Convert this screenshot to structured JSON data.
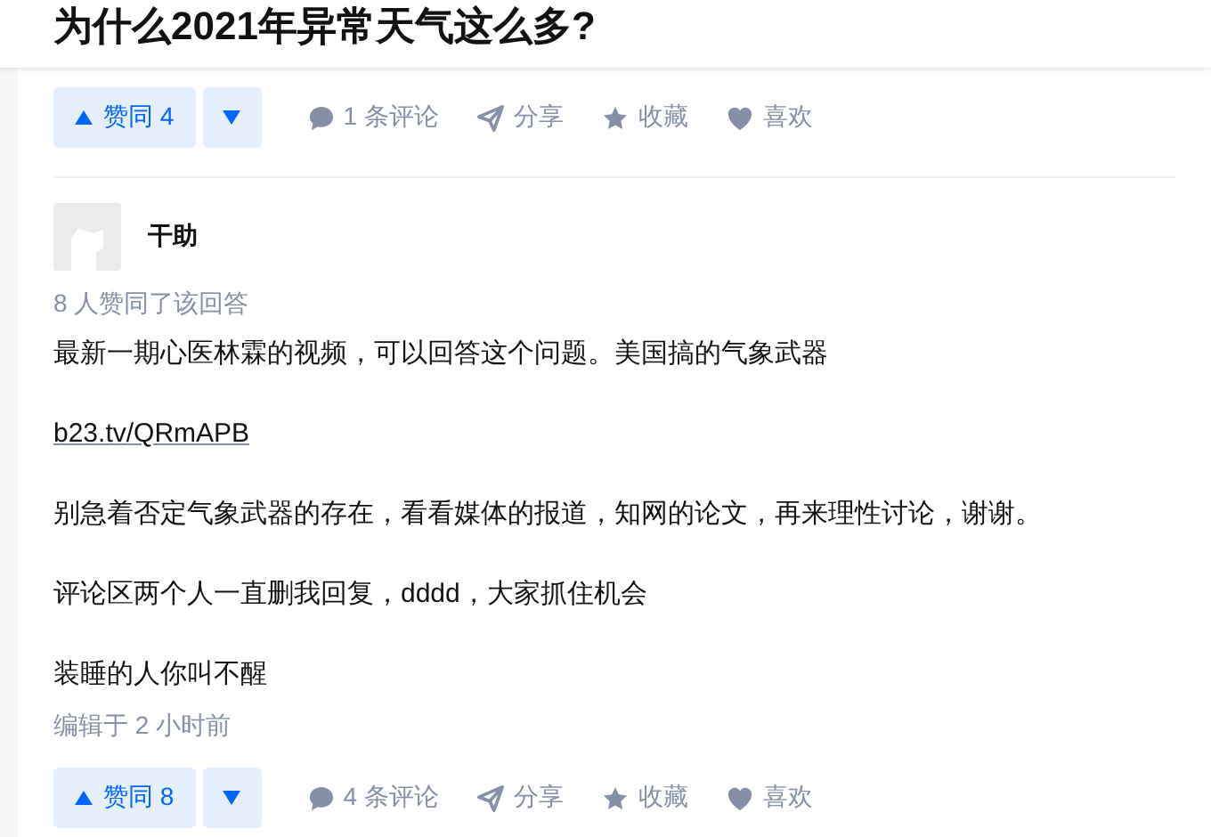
{
  "question": {
    "title": "为什么2021年异常天气这么多?"
  },
  "question_actions": [
    {
      "kind": "upvote",
      "label": "赞同 4"
    },
    {
      "kind": "downvote"
    },
    {
      "kind": "comment",
      "label": "1 条评论"
    },
    {
      "kind": "share",
      "label": "分享"
    },
    {
      "kind": "favorite",
      "label": "收藏"
    },
    {
      "kind": "like",
      "label": "喜欢"
    }
  ],
  "answer": {
    "author": "干助",
    "upvote_summary": "8 人赞同了该回答",
    "paragraphs": [
      {
        "kind": "text",
        "text": "最新一期心医林霖的视频，可以回答这个问题。美国搞的气象武器"
      },
      {
        "kind": "link",
        "text": "b23.tv/QRmAPB"
      },
      {
        "kind": "text",
        "text": "别急着否定气象武器的存在，看看媒体的报道，知网的论文，再来理性讨论，谢谢。"
      },
      {
        "kind": "text",
        "text": "评论区两个人一直删我回复，dddd，大家抓住机会"
      },
      {
        "kind": "text",
        "text": "装睡的人你叫不醒"
      }
    ],
    "edited": "编辑于 2 小时前",
    "actions": [
      {
        "kind": "upvote",
        "label": "赞同 8"
      },
      {
        "kind": "downvote"
      },
      {
        "kind": "comment",
        "label": "4 条评论"
      },
      {
        "kind": "share",
        "label": "分享"
      },
      {
        "kind": "favorite",
        "label": "收藏"
      },
      {
        "kind": "like",
        "label": "喜欢"
      }
    ]
  }
}
